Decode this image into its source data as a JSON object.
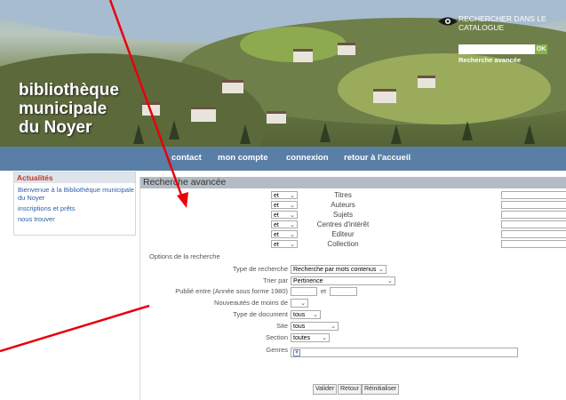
{
  "brand": {
    "line1": "bibliothèque",
    "line2": "municipale",
    "line3": "du Noyer"
  },
  "header_search": {
    "title": "RECHERCHER DANS LE CATALOGUE",
    "input_value": "",
    "ok_label": "OK",
    "advanced_link": "Recherche avancée",
    "icon": "eye-icon"
  },
  "nav": {
    "items": [
      "contact",
      "mon compte",
      "connexion",
      "retour à l'accueil"
    ]
  },
  "sidebar": {
    "title": "Actualités",
    "links": [
      "Bienvenue à la Bibliothèque municipale du Noyer",
      "inscriptions et prêts",
      "nous trouver"
    ]
  },
  "main": {
    "title": "Recherche avancée",
    "criteria": [
      {
        "operator": "et",
        "label": "Titres",
        "value": ""
      },
      {
        "operator": "et",
        "label": "Auteurs",
        "value": ""
      },
      {
        "operator": "et",
        "label": "Sujets",
        "value": ""
      },
      {
        "operator": "et",
        "label": "Centres d'intérêt",
        "value": ""
      },
      {
        "operator": "et",
        "label": "Editeur",
        "value": ""
      },
      {
        "operator": "et",
        "label": "Collection",
        "value": ""
      }
    ],
    "options_title": "Options de la recherche",
    "options": {
      "type_recherche_label": "Type de recherche",
      "type_recherche_value": "Recherche par mots contenus",
      "trier_par_label": "Trier par",
      "trier_par_value": "Pertinence",
      "publie_entre_label": "Publié entre (Année sous forme 1980)",
      "publie_entre_from": "",
      "publie_entre_and": "et",
      "publie_entre_to": "",
      "nouveautes_label": "Nouveautés de moins de",
      "nouveautes_value": "",
      "type_document_label": "Type de document",
      "type_document_value": "tous",
      "site_label": "Site",
      "site_value": "tous",
      "section_label": "Section",
      "section_value": "toutes",
      "genres_label": "Genres",
      "genres_value": ""
    },
    "buttons": {
      "valider": "Valider",
      "retour": "Retour",
      "reinitialiser": "Réinitialiser"
    }
  },
  "colors": {
    "nav_bg": "#5a7fa6",
    "panel_title_bg": "#b3bcc4",
    "sidebar_title": "#c0392b",
    "link": "#2a5ea8",
    "annotation": "#e8000b"
  }
}
